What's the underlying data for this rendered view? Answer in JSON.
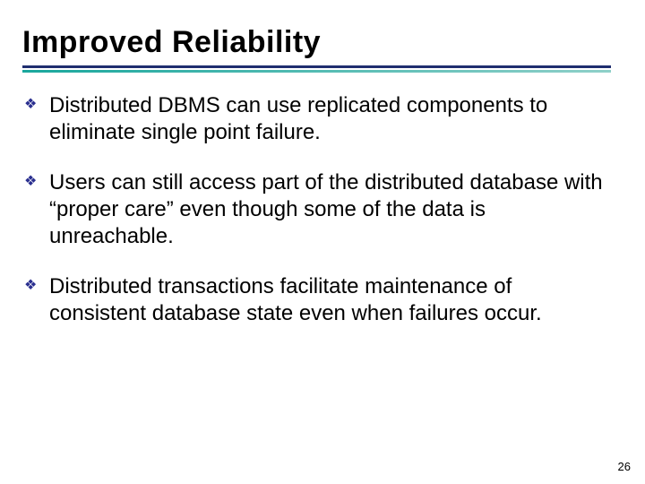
{
  "title": "Improved Reliability",
  "bullets": {
    "b0": "Distributed DBMS can use replicated components to eliminate single point failure.",
    "b1": "Users can still access part of the distributed database with “proper care” even though some of the data is unreachable.",
    "b2": "Distributed transactions facilitate maintenance of consistent database state even when failures occur."
  },
  "pageNumber": "26",
  "bulletGlyph": "❖"
}
